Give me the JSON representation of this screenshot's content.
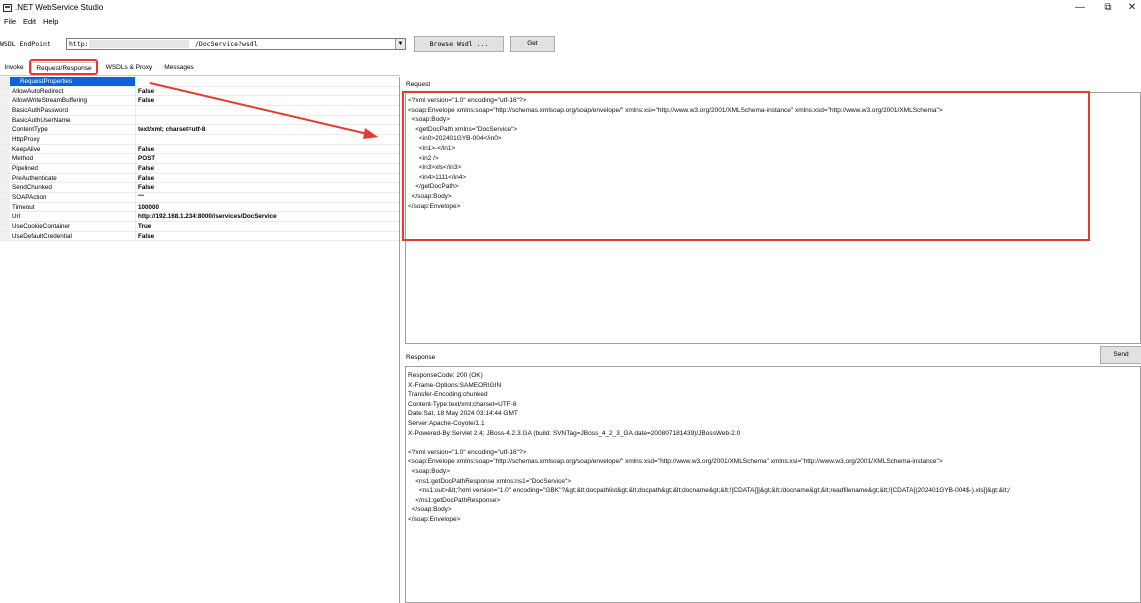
{
  "window": {
    "title": ".NET WebService Studio",
    "minimize_glyph": "—",
    "restore_glyph": "⧉",
    "close_glyph": "✕"
  },
  "menu": [
    "File",
    "Edit",
    "Help"
  ],
  "endpoint": {
    "label": "WSDL EndPoint",
    "value_prefix": "http:/",
    "value_suffix": "/DocService?wsdl",
    "browse_label": "Browse Wsdl ...",
    "get_label": "Get"
  },
  "tabs": [
    "Invoke",
    "Request/Response",
    "WSDLs & Proxy",
    "Messages"
  ],
  "properties": [
    {
      "name": "RequestProperties",
      "value": "",
      "selected": true
    },
    {
      "name": "AllowAutoRedirect",
      "value": "False"
    },
    {
      "name": "AllowWriteStreamBuffering",
      "value": "False"
    },
    {
      "name": "BasicAuthPassword",
      "value": ""
    },
    {
      "name": "BasicAuthUserName",
      "value": ""
    },
    {
      "name": "ContentType",
      "value": "text/xml; charset=utf-8"
    },
    {
      "name": "HttpProxy",
      "value": ""
    },
    {
      "name": "KeepAlive",
      "value": "False"
    },
    {
      "name": "Method",
      "value": "POST"
    },
    {
      "name": "Pipelined",
      "value": "False"
    },
    {
      "name": "PreAuthenticate",
      "value": "False"
    },
    {
      "name": "SendChunked",
      "value": "False"
    },
    {
      "name": "SOAPAction",
      "value": "\"\""
    },
    {
      "name": "Timeout",
      "value": "100000"
    },
    {
      "name": "Url",
      "value": "http://192.168.1.234:8000//services/DocService"
    },
    {
      "name": "UseCookieContainer",
      "value": "True"
    },
    {
      "name": "UseDefaultCredential",
      "value": "False"
    }
  ],
  "request": {
    "label": "Request",
    "body": "<?xml version=\"1.0\" encoding=\"utf-16\"?>\n<soap:Envelope xmlns:soap=\"http://schemas.xmlsoap.org/soap/envelope/\" xmlns:xsi=\"http://www.w3.org/2001/XMLSchema-instance\" xmlns:xsd=\"http://www.w3.org/2001/XMLSchema\">\n  <soap:Body>\n    <getDocPath xmlns=\"DocService\">\n      <in0>202401GYB-004</in0>\n      <in1>-</in1>\n      <in2 />\n      <in3>xls</in3>\n      <in4>1111</in4>\n    </getDocPath>\n  </soap:Body>\n</soap:Envelope>"
  },
  "response": {
    "label": "Response",
    "send_label": "Send",
    "body": "ResponseCode: 200 (OK)\nX-Frame-Options:SAMEORIGIN\nTransfer-Encoding:chunked\nContent-Type:text/xml;charset=UTF-8\nDate:Sat, 18 May 2024 03:14:44 GMT\nServer:Apache-Coyote/1.1\nX-Powered-By:Servlet 2.4; JBoss-4.2.3.GA (build: SVNTag=JBoss_4_2_3_GA date=200807181439)/JBossWeb-2.0\n\n<?xml version=\"1.0\" encoding=\"utf-16\"?>\n<soap:Envelope xmlns:soap=\"http://schemas.xmlsoap.org/soap/envelope/\" xmlns:xsd=\"http://www.w3.org/2001/XMLSchema\" xmlns:xsi=\"http://www.w3.org/2001/XMLSchema-instance\">\n  <soap:Body>\n    <ns1:getDocPathResponse xmlns:ns1=\"DocService\">\n      <ns1:out>&lt;?xml version=\"1.0\" encoding=\"GBK\"?&gt;&lt;docpathlist&gt;&lt;docpath&gt;&lt;docname&gt;&lt;![CDATA[]]&gt;&lt;/docname&gt;&lt;readfilename&gt;&lt;![CDATA[(202401GYB-004$-).xls]]&gt;&lt;/\n    </ns1:getDocPathResponse>\n  </soap:Body>\n</soap:Envelope>"
  },
  "annotation_color": "#e33b2f"
}
